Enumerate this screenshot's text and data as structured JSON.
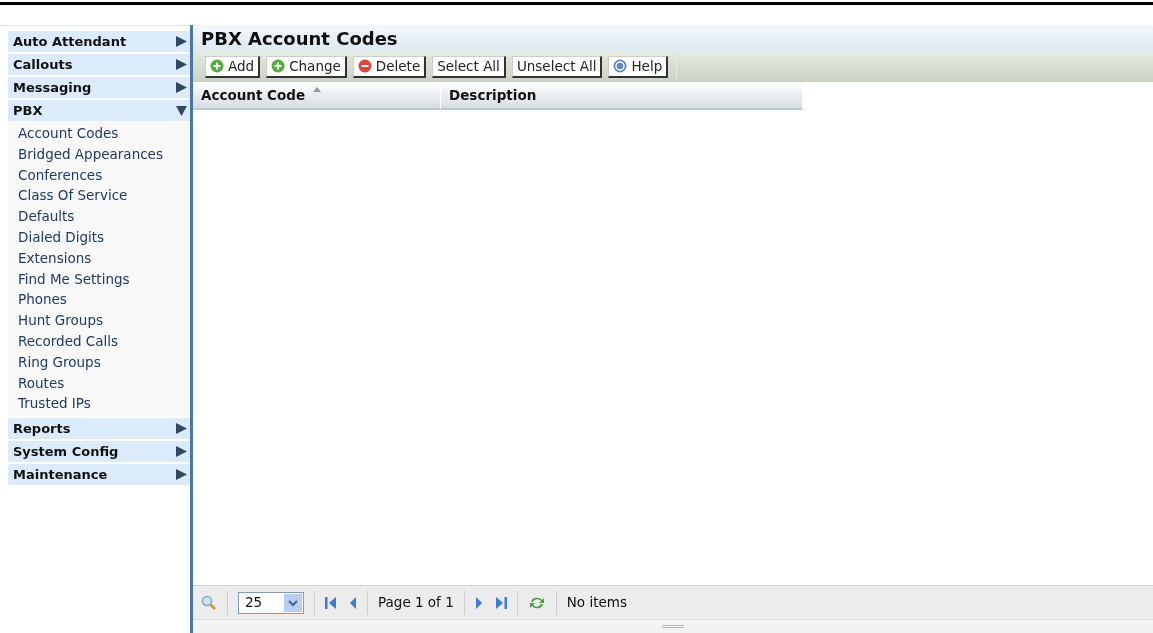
{
  "sidebar": {
    "sections": [
      {
        "label": "Auto Attendant",
        "expanded": false
      },
      {
        "label": "Callouts",
        "expanded": false
      },
      {
        "label": "Messaging",
        "expanded": false
      },
      {
        "label": "PBX",
        "expanded": true,
        "children": [
          "Account Codes",
          "Bridged Appearances",
          "Conferences",
          "Class Of Service",
          "Defaults",
          "Dialed Digits",
          "Extensions",
          "Find Me Settings",
          "Phones",
          "Hunt Groups",
          "Recorded Calls",
          "Ring Groups",
          "Routes",
          "Trusted IPs"
        ]
      },
      {
        "label": "Reports",
        "expanded": false
      },
      {
        "label": "System Config",
        "expanded": false
      },
      {
        "label": "Maintenance",
        "expanded": false
      }
    ]
  },
  "panel": {
    "title": "PBX Account Codes",
    "toolbar": [
      {
        "label": "Add",
        "kind": "add"
      },
      {
        "label": "Change",
        "kind": "add"
      },
      {
        "label": "Delete",
        "kind": "delete"
      },
      {
        "label": "Select All",
        "kind": "plain"
      },
      {
        "label": "Unselect All",
        "kind": "plain"
      },
      {
        "label": "Help",
        "kind": "help"
      }
    ],
    "columns": [
      {
        "label": "Account Code",
        "sorted": true
      },
      {
        "label": "Description",
        "sorted": false
      }
    ],
    "pager": {
      "page_size": "25",
      "page_info": "Page 1 of 1",
      "status": "No items"
    }
  }
}
